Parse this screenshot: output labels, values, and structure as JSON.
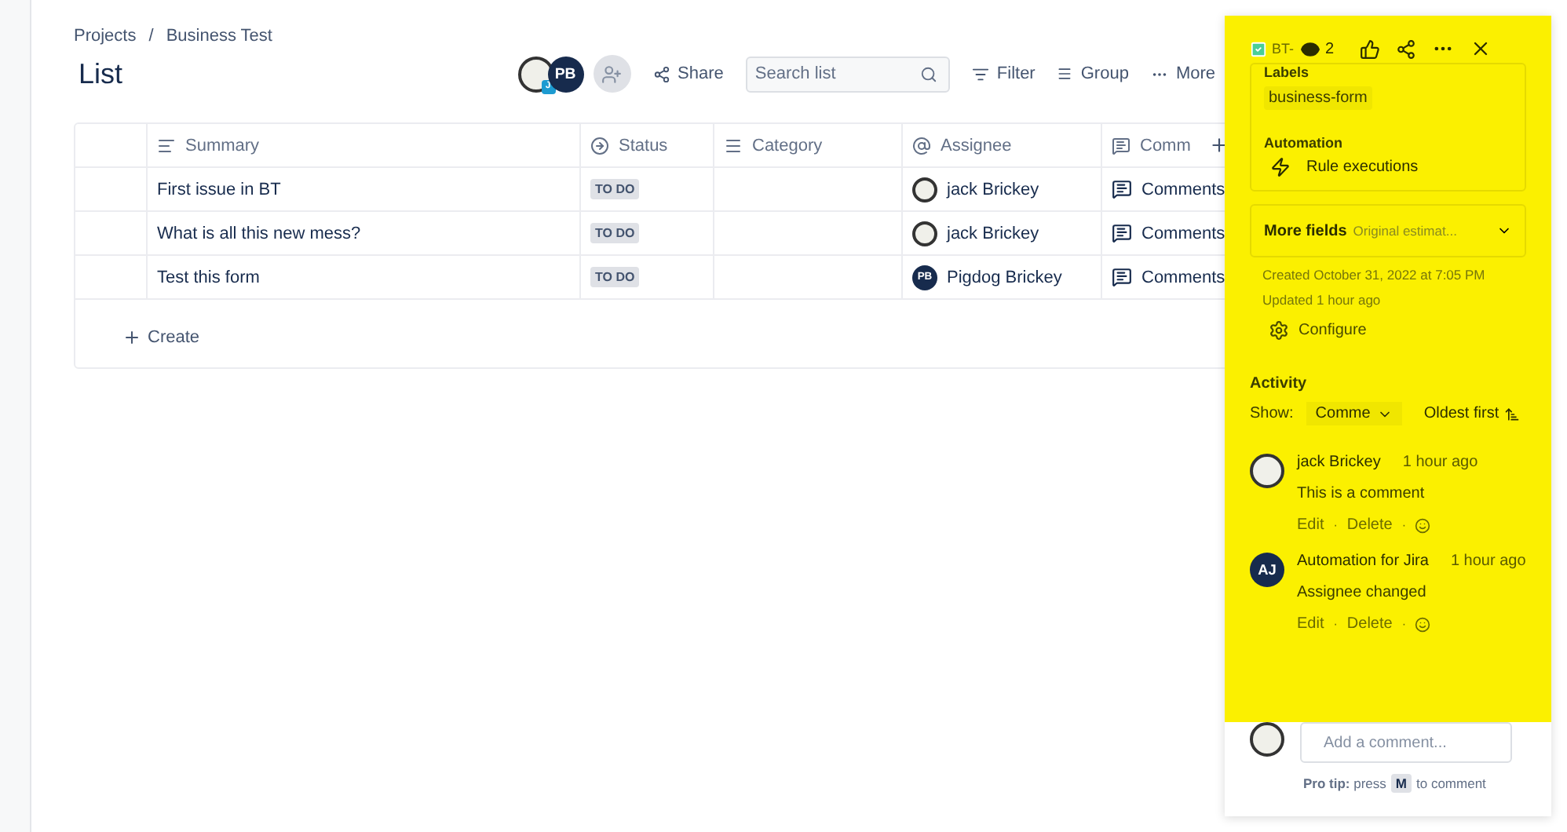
{
  "breadcrumbs": [
    "Projects",
    "Business Test"
  ],
  "breadcrumb_separator": "/",
  "page_title": "List",
  "toolbar": {
    "avatars": [
      {
        "kind": "image",
        "badge": "J"
      },
      {
        "kind": "initials",
        "initials": "PB"
      }
    ],
    "share": "Share",
    "search": {
      "placeholder": "Search list"
    },
    "filter": "Filter",
    "group": "Group",
    "more": "More"
  },
  "table": {
    "columns": [
      {
        "kind": "summary",
        "label": "Summary"
      },
      {
        "kind": "status",
        "label": "Status"
      },
      {
        "kind": "category",
        "label": "Category"
      },
      {
        "kind": "assignee",
        "label": "Assignee"
      },
      {
        "kind": "comments",
        "label": "Comm"
      }
    ],
    "rows": [
      {
        "summary": "First issue in BT",
        "status": "TO DO",
        "assignee": {
          "kind": "image",
          "name": "jack Brickey"
        },
        "comments": "Comments"
      },
      {
        "summary": "What is all this new mess?",
        "status": "TO DO",
        "assignee": {
          "kind": "image",
          "name": "jack Brickey"
        },
        "comments": "Comments"
      },
      {
        "summary": "Test this form",
        "status": "TO DO",
        "assignee": {
          "kind": "initials",
          "initials": "PB",
          "name": "Pigdog Brickey"
        },
        "comments": "Comments"
      }
    ],
    "create": "Create"
  },
  "panel": {
    "issue_key": "BT-",
    "watchers": "2",
    "labels": {
      "heading": "Labels",
      "items": [
        "business-form"
      ]
    },
    "automation": {
      "heading": "Automation",
      "item": "Rule executions"
    },
    "more_fields": {
      "label": "More fields",
      "hint": "Original estimat..."
    },
    "created": "Created October 31, 2022 at 7:05 PM",
    "updated": "Updated 1 hour ago",
    "configure": "Configure",
    "activity": {
      "heading": "Activity",
      "show_label": "Show:",
      "show_value": "Comme",
      "sort": "Oldest first",
      "comments": [
        {
          "avatar": {
            "kind": "image"
          },
          "author": "jack Brickey",
          "time": "1 hour ago",
          "text": "This is a comment",
          "actions": [
            "Edit",
            "Delete"
          ],
          "separator": "·"
        },
        {
          "avatar": {
            "kind": "initials",
            "initials": "AJ"
          },
          "author": "Automation for Jira",
          "time": "1 hour ago",
          "text": "Assignee changed",
          "actions": [
            "Edit",
            "Delete"
          ],
          "separator": "·"
        }
      ]
    },
    "add_comment": {
      "placeholder": "Add a comment...",
      "tip": "**Pro tip:** press",
      "key": "M",
      "tip_end": "to comment"
    }
  }
}
